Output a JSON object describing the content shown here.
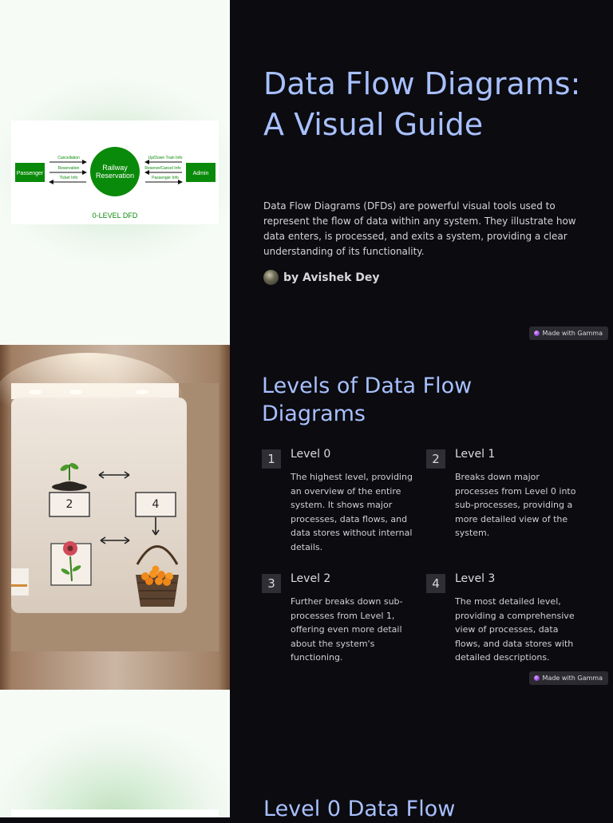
{
  "hero": {
    "title": "Data Flow Diagrams: A Visual Guide",
    "intro": "Data Flow Diagrams (DFDs) are powerful visual tools used to represent the flow of data within any system. They illustrate how data enters, is processed, and exits a system, providing a clear understanding of its functionality.",
    "author": "by Avishek Dey"
  },
  "dfd_image": {
    "passenger": "Passenger",
    "process": [
      "Railway",
      "Reservation"
    ],
    "admin": "Admin",
    "left_flows": [
      "Cancellation",
      "Reservation",
      "Ticket Info"
    ],
    "right_flows": [
      "Up/Down Train Info",
      "Reserve/Cancel Info",
      "Passenger Info"
    ],
    "caption": "0-LEVEL DFD",
    "green": "#0a8a0a"
  },
  "illustration": {
    "box_labels": [
      "2",
      "4"
    ]
  },
  "badge": "Made with Gamma",
  "levels_section": {
    "title": "Levels of Data Flow Diagrams",
    "levels": [
      {
        "num": "1",
        "title": "Level 0",
        "desc": "The highest level, providing an overview of the entire system. It shows major processes, data flows, and data stores without internal details."
      },
      {
        "num": "2",
        "title": "Level 1",
        "desc": "Breaks down major processes from Level 0 into sub-processes, providing a more detailed view of the system."
      },
      {
        "num": "3",
        "title": "Level 2",
        "desc": "Further breaks down sub-processes from Level 1, offering even more detail about the system's functioning."
      },
      {
        "num": "4",
        "title": "Level 3",
        "desc": "The most detailed level, providing a comprehensive view of processes, data flows, and data stores with detailed descriptions."
      }
    ]
  },
  "next_section": {
    "title": "Level 0 Data Flow"
  },
  "colors": {
    "background": "#0b0b10",
    "heading": "#a8c0ff",
    "body_text": "#d4d4d8"
  }
}
